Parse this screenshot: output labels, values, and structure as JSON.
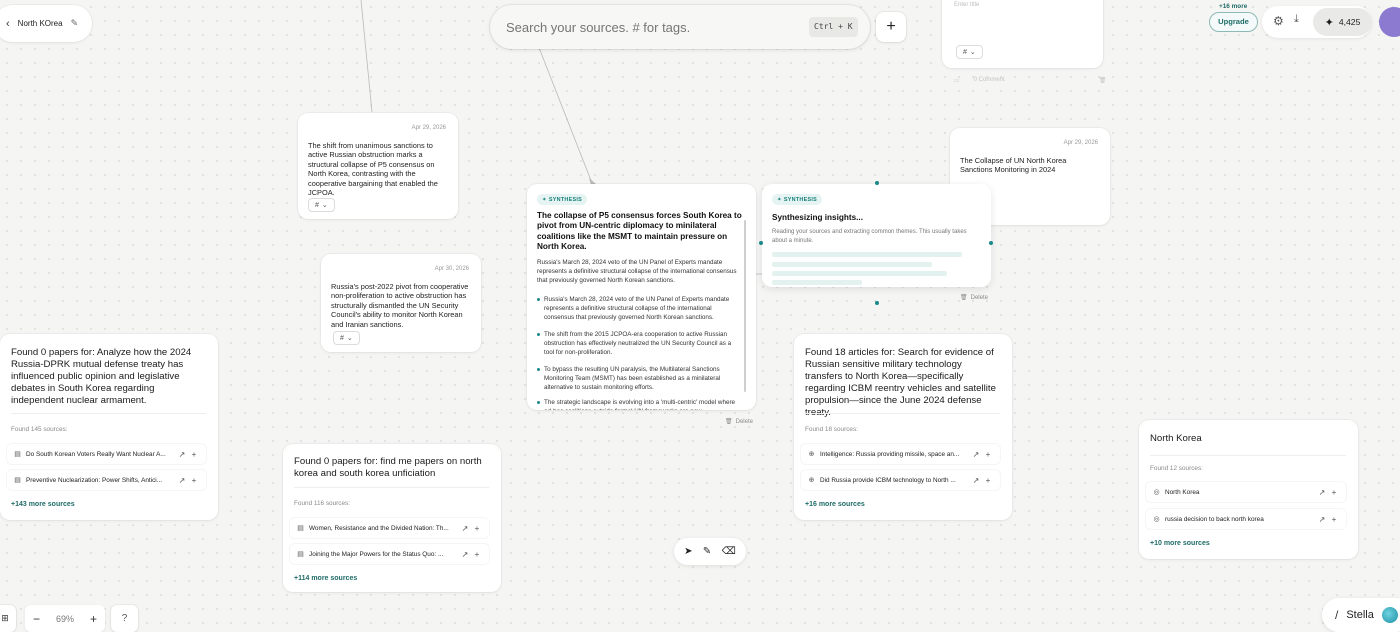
{
  "project": {
    "title": "North KOrea"
  },
  "search": {
    "placeholder": "Search your sources. # for tags.",
    "shortcut": "Ctrl + K"
  },
  "topbar": {
    "upgrade_label": "Upgrade",
    "credits": "4,425"
  },
  "top_partial": {
    "placeholder": "Enter title",
    "comment_label": "0 Comment",
    "more_label": "+16 more"
  },
  "notes": [
    {
      "date": "Apr 29, 2026",
      "text": "The shift from unanimous sanctions to active Russian obstruction marks a structural collapse of P5 consensus on North Korea, contrasting with the cooperative bargaining that enabled the JCPOA.",
      "tag": "#"
    },
    {
      "date": "Apr 30, 2026",
      "text": "Russia's post-2022 pivot from cooperative non-proliferation to active obstruction has structurally dismantled the UN Security Council's ability to monitor North Korean and Iranian sanctions.",
      "tag": "#"
    },
    {
      "date": "Apr 29, 2026",
      "text": "The Collapse of UN North Korea Sanctions Monitoring in 2024"
    }
  ],
  "synthesis": {
    "badge": "SYNTHESIS",
    "title": "The collapse of P5 consensus forces South Korea to pivot from UN-centric diplomacy to minilateral coalitions like the MSMT to maintain pressure on North Korea.",
    "intro": "Russia's March 28, 2024 veto of the UN Panel of Experts mandate represents a definitive structural collapse of the international consensus that previously governed North Korean sanctions.",
    "bullets": [
      "Russia's March 28, 2024 veto of the UN Panel of Experts mandate represents a definitive structural collapse of the international consensus that previously governed North Korean sanctions.",
      "The shift from the 2015 JCPOA-era cooperation to active Russian obstruction has effectively neutralized the UN Security Council as a tool for non-proliferation.",
      "To bypass the resulting UN paralysis, the Multilateral Sanctions Monitoring Team (MSMT) has been established as a minilateral alternative to sustain monitoring efforts.",
      "The strategic landscape is evolving into a 'multi-centric' model where ad-hoc coalitions outside formal UN frameworks are now"
    ],
    "delete_label": "Delete"
  },
  "synthesizing": {
    "badge": "SYNTHESIS",
    "title": "Synthesizing insights...",
    "subtitle": "Reading your sources and extracting common themes. This usually takes about a minute.",
    "delete_label": "Delete"
  },
  "queries": [
    {
      "title": "Found 0 papers for: Analyze how the 2024 Russia-DPRK mutual defense treaty has influenced public opinion and legislative debates in South Korea regarding independent nuclear armament.",
      "count": "Found 145 sources:",
      "sources": [
        "Do South Korean Voters Really Want Nuclear A...",
        "Preventive Nuclearization: Power Shifts, Antici..."
      ],
      "more": "+143 more sources"
    },
    {
      "title": "Found 0 papers for: find me papers on north korea and south korea unficiation",
      "count": "Found 116 sources:",
      "sources": [
        "Women, Resistance and the Divided Nation: Th...",
        "Joining the Major Powers for the Status Quo: ..."
      ],
      "more": "+114 more sources"
    },
    {
      "title": "Found 18 articles for: Search for evidence of Russian sensitive military technology transfers to North Korea—specifically regarding ICBM reentry vehicles and satellite propulsion—since the June 2024 defense treaty.",
      "count": "Found 18 sources:",
      "sources": [
        "Intelligence: Russia providing missile, space an...",
        "Did Russia provide ICBM technology to North ..."
      ],
      "more": "+16 more sources"
    },
    {
      "title": "North Korea",
      "count": "Found 12 sources:",
      "sources": [
        "North Korea",
        "russia decision to back north korea"
      ],
      "more": "+10 more sources"
    }
  ],
  "zoom": {
    "level": "69%"
  },
  "help_label": "?",
  "assistant": {
    "name": "Stella"
  }
}
